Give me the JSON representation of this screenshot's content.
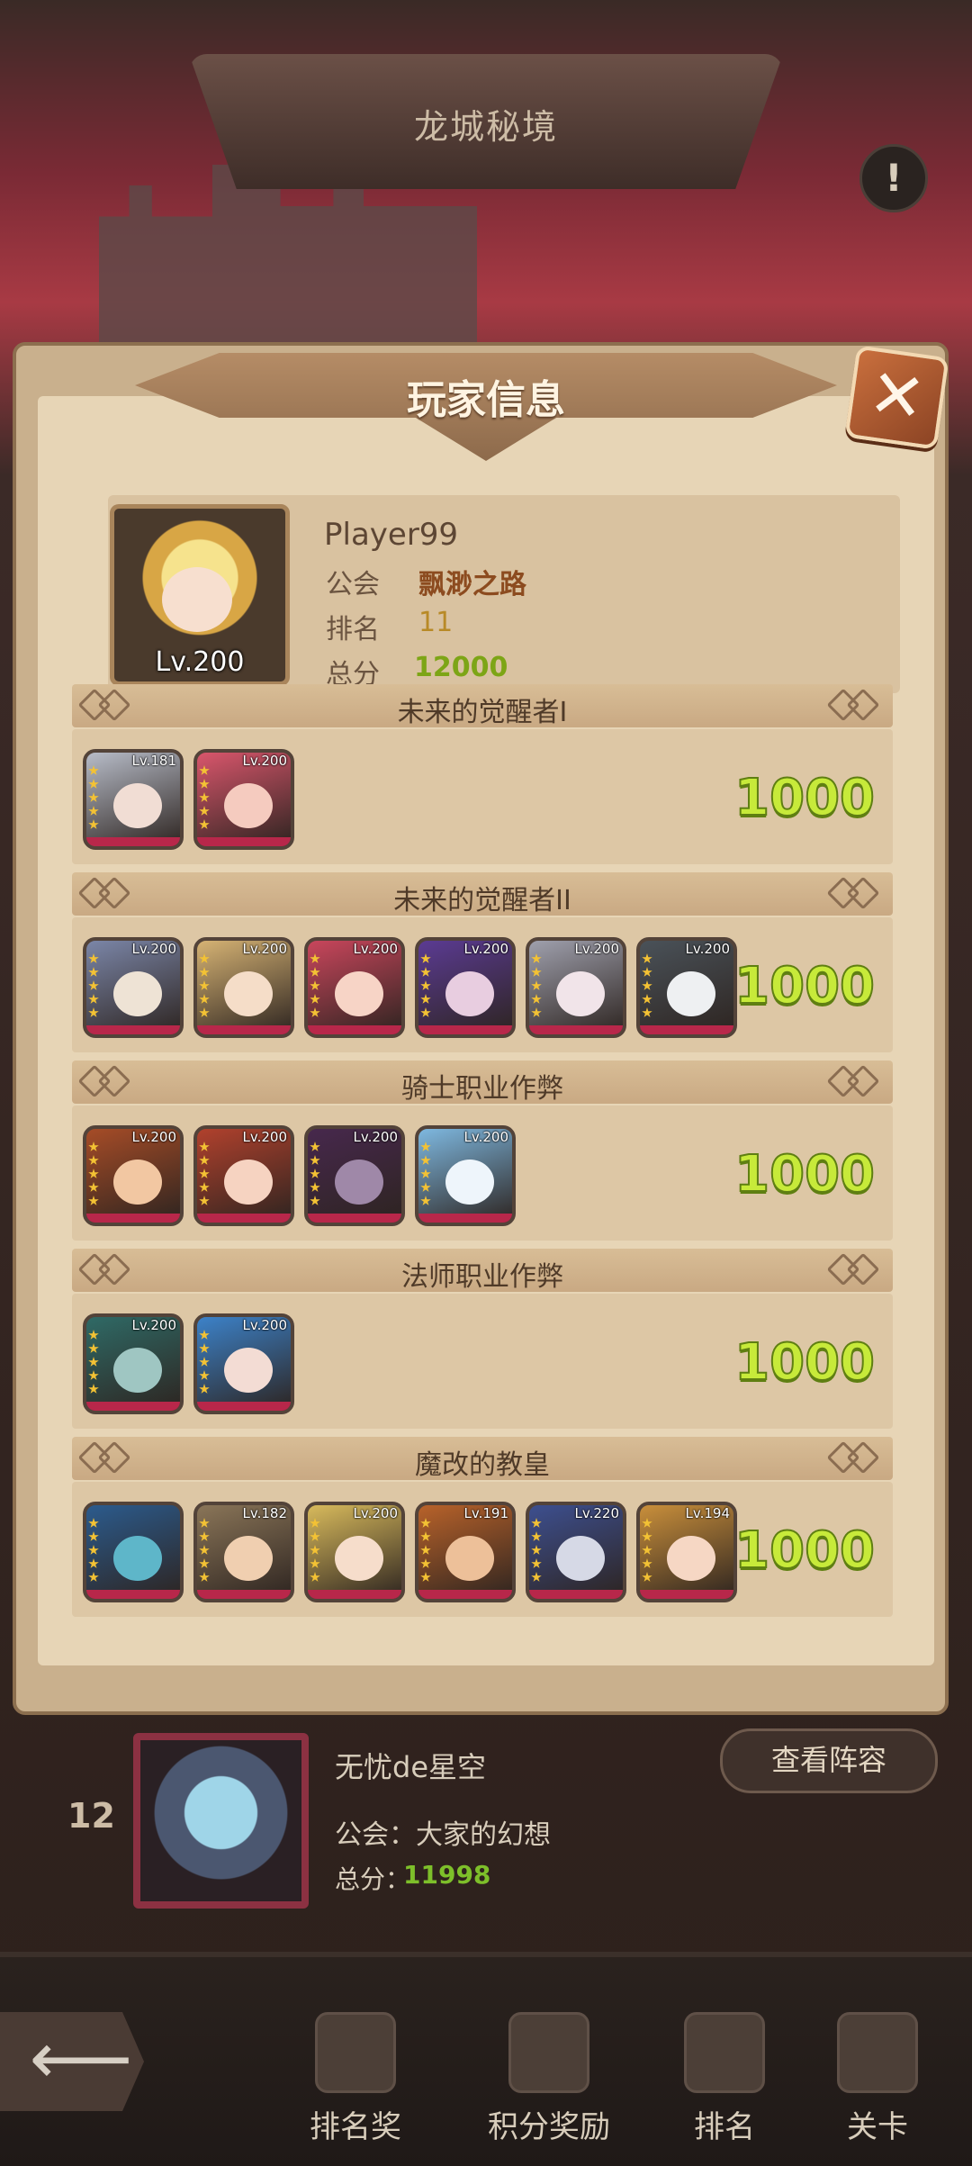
{
  "top_title": "龙城秘境",
  "info_icon": "!",
  "dialog": {
    "title": "玩家信息",
    "close": "✕"
  },
  "player": {
    "name": "Player99",
    "level": "Lv.200",
    "guild_label": "公会",
    "guild": "飘渺之路",
    "rank_label": "排名",
    "rank": "11",
    "score_label": "总分",
    "score": "12000"
  },
  "teams": [
    {
      "name": "未来的觉醒者I",
      "score": "1000",
      "heroes": [
        {
          "lv": "Lv.181",
          "color": "#b7bcc8",
          "face": "#f1ddd4"
        },
        {
          "lv": "Lv.200",
          "color": "#d9566c",
          "face": "#f5cbbf"
        }
      ]
    },
    {
      "name": "未来的觉醒者II",
      "score": "1000",
      "heroes": [
        {
          "lv": "Lv.200",
          "color": "#7b86a8",
          "face": "#eee3d5"
        },
        {
          "lv": "Lv.200",
          "color": "#d6b374",
          "face": "#f5ddc8"
        },
        {
          "lv": "Lv.200",
          "color": "#c9465c",
          "face": "#f7d4c6"
        },
        {
          "lv": "Lv.200",
          "color": "#5b3b93",
          "face": "#e8cde0"
        },
        {
          "lv": "Lv.200",
          "color": "#9fa0ad",
          "face": "#f1e4e9"
        },
        {
          "lv": "Lv.200",
          "color": "#4a5259",
          "face": "#eef0f2"
        }
      ]
    },
    {
      "name": "骑士职业作弊",
      "score": "1000",
      "heroes": [
        {
          "lv": "Lv.200",
          "color": "#a64c27",
          "face": "#f2c7a2"
        },
        {
          "lv": "Lv.200",
          "color": "#b1412d",
          "face": "#f6d3c1"
        },
        {
          "lv": "Lv.200",
          "color": "#47284d",
          "face": "#9f88a8"
        },
        {
          "lv": "Lv.200",
          "color": "#7eb8e0",
          "face": "#eef5fb"
        }
      ]
    },
    {
      "name": "法师职业作弊",
      "score": "1000",
      "heroes": [
        {
          "lv": "Lv.200",
          "color": "#2f6a66",
          "face": "#9fc6c2"
        },
        {
          "lv": "Lv.200",
          "color": "#3c82c9",
          "face": "#f3dcd4"
        }
      ]
    },
    {
      "name": "魔改的教皇",
      "score": "1000",
      "heroes": [
        {
          "lv": "",
          "color": "#2c5b8d",
          "face": "#5eb6c9"
        },
        {
          "lv": "Lv.182",
          "color": "#8a7558",
          "face": "#f0cfb0"
        },
        {
          "lv": "Lv.200",
          "color": "#d8ba5c",
          "face": "#f6ddcb"
        },
        {
          "lv": "Lv.191",
          "color": "#b8622a",
          "face": "#edc099"
        },
        {
          "lv": "Lv.220",
          "color": "#3d4f8f",
          "face": "#d6d9e6"
        },
        {
          "lv": "Lv.194",
          "color": "#c98f3b",
          "face": "#f6d7c4"
        }
      ]
    }
  ],
  "next_entry": {
    "rank": "12",
    "name": "无忧de星空",
    "guild": "公会：大家的幻想",
    "score_label": "总分：",
    "score": "11998",
    "button": "查看阵容"
  },
  "nav": {
    "back_icon": "back-arrow-icon",
    "items": [
      "排名奖",
      "积分奖励",
      "排名",
      "关卡"
    ]
  }
}
